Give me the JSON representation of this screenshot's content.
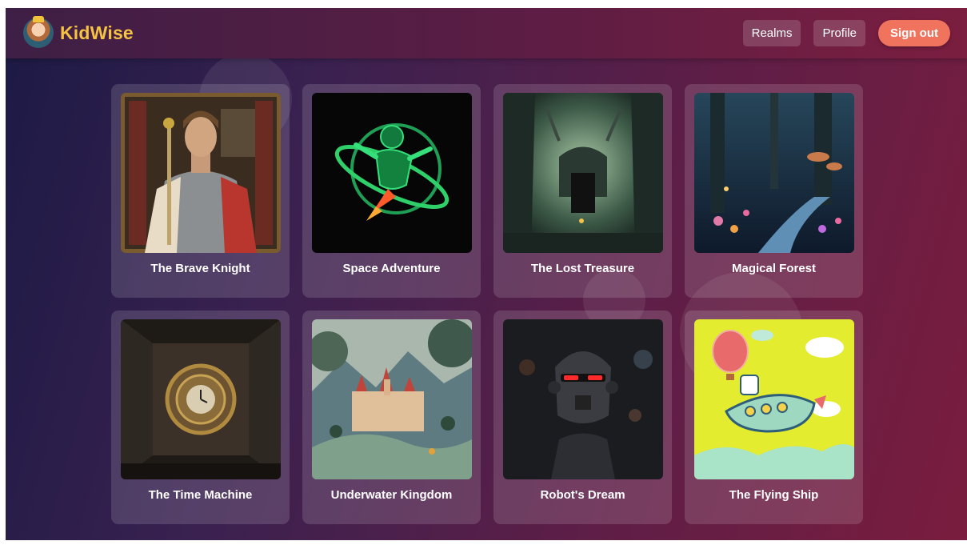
{
  "brand": {
    "name": "KidWise",
    "logo_icon": "princess-avatar-icon"
  },
  "nav": {
    "realms": "Realms",
    "profile": "Profile",
    "sign_out": "Sign out"
  },
  "colors": {
    "brand_text": "#f5c242",
    "sign_out_bg": "#f0735e"
  },
  "stories": [
    {
      "title": "The Brave Knight",
      "image": "knight-illustration"
    },
    {
      "title": "Space Adventure",
      "image": "astronaut-rocket-illustration"
    },
    {
      "title": "The Lost Treasure",
      "image": "forest-ruins-illustration"
    },
    {
      "title": "Magical Forest",
      "image": "glowing-forest-illustration"
    },
    {
      "title": "The Time Machine",
      "image": "clock-vault-illustration"
    },
    {
      "title": "Underwater Kingdom",
      "image": "castle-landscape-illustration"
    },
    {
      "title": "Robot's Dream",
      "image": "robot-illustration"
    },
    {
      "title": "The Flying Ship",
      "image": "flying-ship-illustration"
    }
  ]
}
